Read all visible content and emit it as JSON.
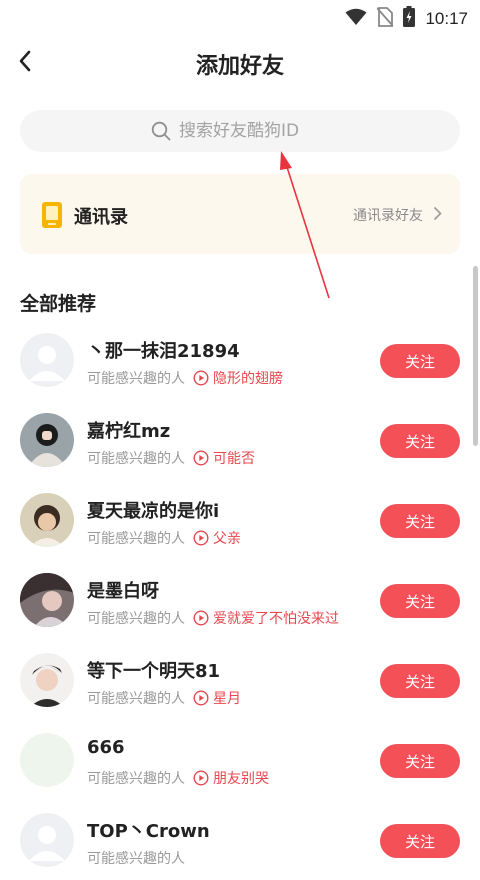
{
  "status_bar": {
    "time": "10:17"
  },
  "header": {
    "title": "添加好友"
  },
  "search": {
    "placeholder": "搜索好友酷狗ID"
  },
  "contacts": {
    "title": "通讯录",
    "link": "通讯录好友"
  },
  "section": {
    "title": "全部推荐"
  },
  "recommendations": [
    {
      "name": "丶那一抹泪21894",
      "reason": "可能感兴趣的人",
      "song": "隐形的翅膀",
      "follow": "关注"
    },
    {
      "name": "嘉柠红mz",
      "reason": "可能感兴趣的人",
      "song": "可能否",
      "follow": "关注"
    },
    {
      "name": "夏天最凉的是你i",
      "reason": "可能感兴趣的人",
      "song": "父亲",
      "follow": "关注"
    },
    {
      "name": "是墨白呀",
      "reason": "可能感兴趣的人",
      "song": "爱就爱了不怕没来过",
      "follow": "关注"
    },
    {
      "name": "等下一个明天81",
      "reason": "可能感兴趣的人",
      "song": "星月",
      "follow": "关注"
    },
    {
      "name": "666",
      "reason": "可能感兴趣的人",
      "song": "朋友别哭",
      "follow": "关注"
    },
    {
      "name": "TOP丶Crown",
      "reason": "可能感兴趣的人",
      "song": "",
      "follow": "关注"
    }
  ],
  "colors": {
    "accent": "#f45058",
    "song": "#e8474f",
    "card_bg": "#fdf8ee",
    "annotation": "#e8343e"
  }
}
